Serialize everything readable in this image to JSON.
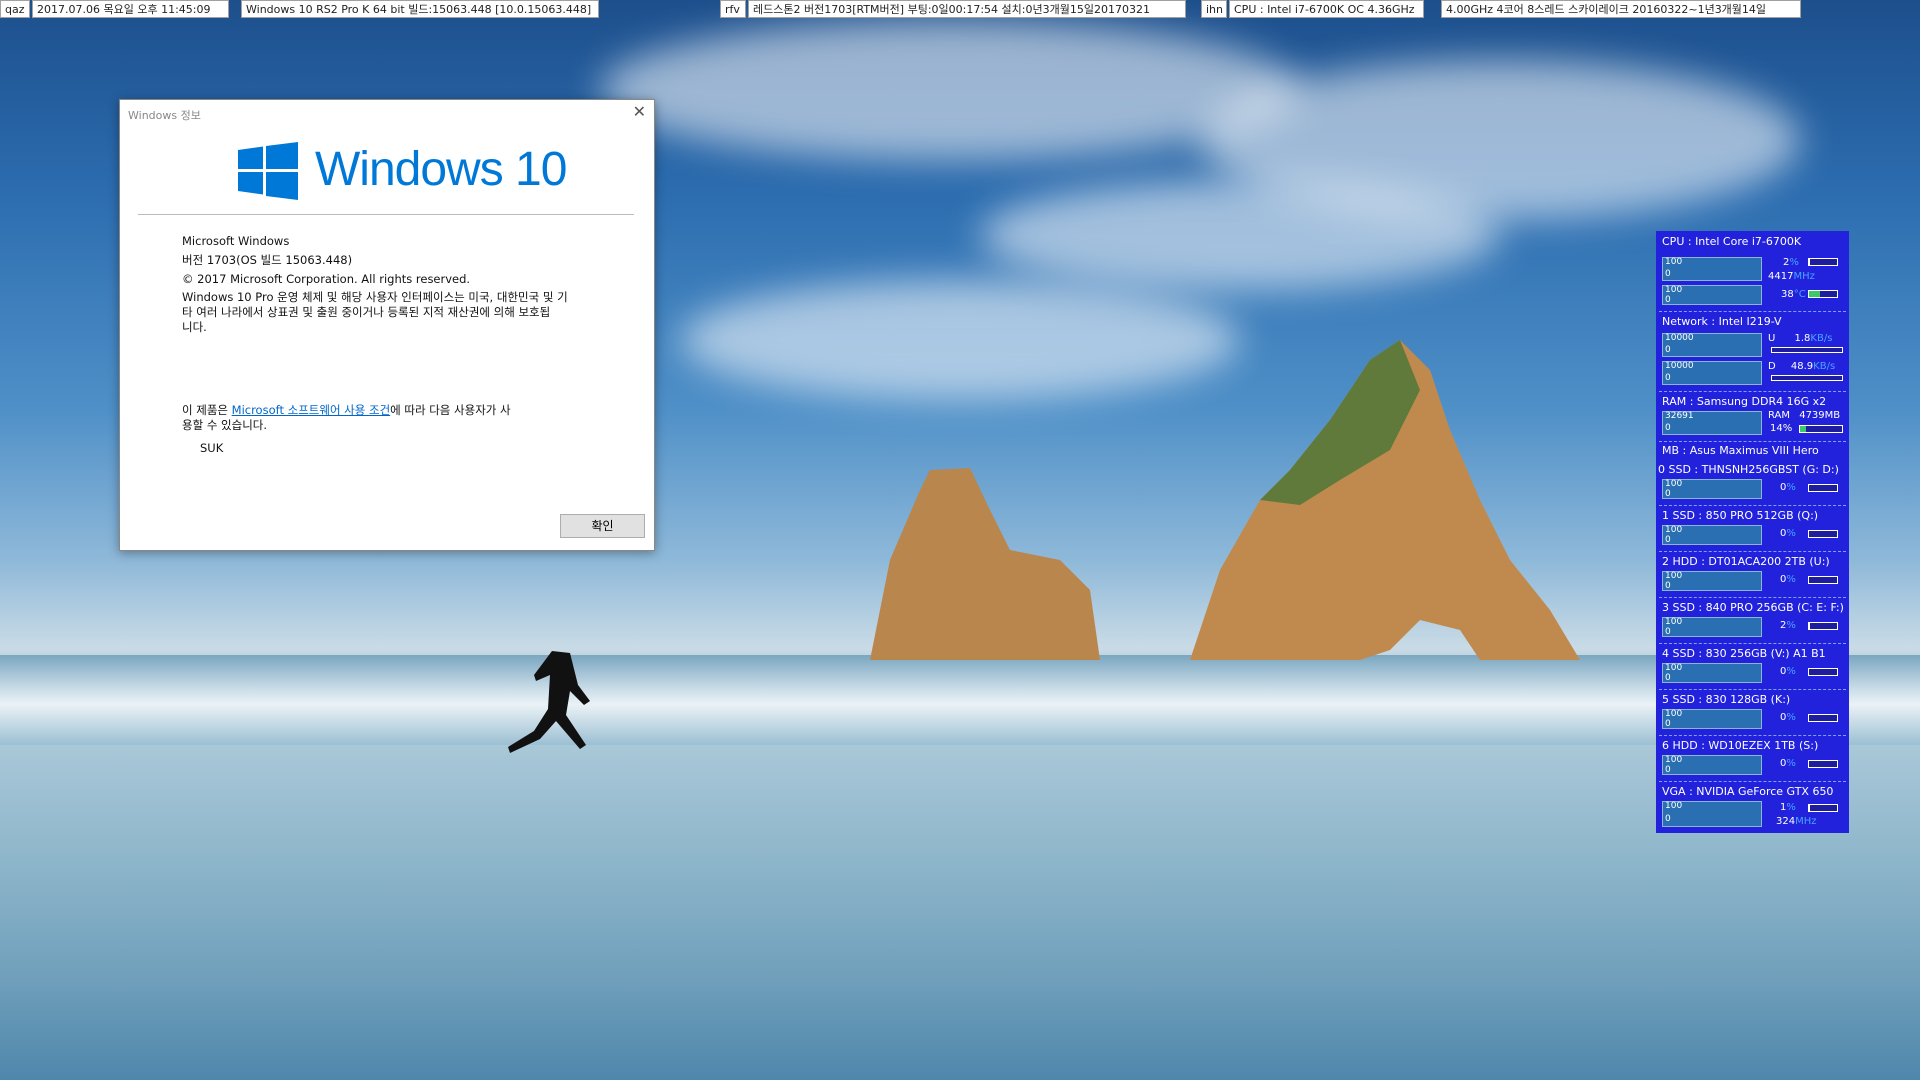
{
  "topbar": [
    {
      "text": "qaz"
    },
    {
      "text": "2017.07.06 목요일  오후 11:45:09"
    },
    {
      "text": "Windows 10 RS2 Pro K 64 bit 빌드:15063.448 [10.0.15063.448]"
    },
    {
      "text": "rfv"
    },
    {
      "text": "레드스톤2 버전1703[RTM버전] 부팅:0일00:17:54 설치:0년3개월15일20170321"
    },
    {
      "text": "ihn"
    },
    {
      "text": "CPU : Intel i7-6700K OC 4.36GHz"
    },
    {
      "text": "4.00GHz 4코어 8스레드 스카이레이크 20160322~1년3개월14일"
    }
  ],
  "dialog": {
    "title": "Windows 정보",
    "logo_text": "Windows 10",
    "product": "Microsoft Windows",
    "version": "버전 1703(OS 빌드 15063.448)",
    "copyright": "© 2017 Microsoft Corporation. All rights reserved.",
    "desc_line1": "Windows 10 Pro 운영 체제 및 해당 사용자 인터페이스는 미국, 대한민국 및 기",
    "desc_line2": "타 여러 나라에서 상표권 및 출원 중이거나 등록된 지적 재산권에 의해 보호됩",
    "desc_line3": "니다.",
    "license_prefix": "이 제품은 ",
    "license_link": "Microsoft 소프트웨어 사용 조건",
    "license_suffix": "에 따라 다음 사용자가 사",
    "license_line2": "용할 수 있습니다.",
    "user": "SUK",
    "ok_label": "확인"
  },
  "monitor": {
    "cpu": {
      "title": "CPU : Intel Core i7-6700K",
      "g1_top": "100",
      "g1_bot": "0",
      "g2_top": "100",
      "g2_bot": "0",
      "load": "2",
      "load_unit": "%",
      "freq": "4417",
      "freq_unit": "MHz",
      "temp": "38",
      "temp_unit": "°C",
      "load_level": 0.02,
      "temp_level": 0.38
    },
    "network": {
      "title": "Network : Intel  I219-V",
      "g1_top": "10000",
      "g1_bot": "0",
      "g2_top": "10000",
      "g2_bot": "0",
      "up_label": "U",
      "up_val": "1.8",
      "up_unit": "KB/s",
      "down_label": "D",
      "down_val": "48.9",
      "down_unit": "KB/s"
    },
    "ram": {
      "title": "RAM : Samsung DDR4 16G x2",
      "g_top": "32691",
      "g_bot": "0",
      "label": "RAM",
      "used": "4739MB",
      "pct": "14%",
      "level": 0.14
    },
    "mb": {
      "title": "MB : Asus Maximus VIII Hero"
    },
    "disks": [
      {
        "title": "0 SSD : THNSNH256GBST (G: D:)",
        "g_top": "100",
        "g_bot": "0",
        "val": "0",
        "unit": "%",
        "level": 0
      },
      {
        "title": "1 SSD : 850 PRO 512GB (Q:)",
        "g_top": "100",
        "g_bot": "0",
        "val": "0",
        "unit": "%",
        "level": 0
      },
      {
        "title": "2 HDD : DT01ACA200 2TB (U:)",
        "g_top": "100",
        "g_bot": "0",
        "val": "0",
        "unit": "%",
        "level": 0
      },
      {
        "title": "3 SSD : 840 PRO 256GB (C: E: F:)",
        "g_top": "100",
        "g_bot": "0",
        "val": "2",
        "unit": "%",
        "level": 0.02
      },
      {
        "title": "4 SSD : 830  256GB (V:) A1 B1",
        "g_top": "100",
        "g_bot": "0",
        "val": "0",
        "unit": "%",
        "level": 0
      },
      {
        "title": "5 SSD : 830  128GB (K:)",
        "g_top": "100",
        "g_bot": "0",
        "val": "0",
        "unit": "%",
        "level": 0
      },
      {
        "title": "6 HDD : WD10EZEX 1TB (S:)",
        "g_top": "100",
        "g_bot": "0",
        "val": "0",
        "unit": "%",
        "level": 0
      }
    ],
    "vga": {
      "title": "VGA : NVIDIA GeForce GTX 650",
      "g_top": "100",
      "g_bot": "0",
      "load": "1",
      "load_unit": "%",
      "freq": "324",
      "freq_unit": "MHz",
      "level": 0.01
    }
  },
  "colors": {
    "monitor_bg": "#2222dd",
    "accent": "#0078d7",
    "graph_bg": "#2a6fb2",
    "unit": "#4aa3ff"
  }
}
